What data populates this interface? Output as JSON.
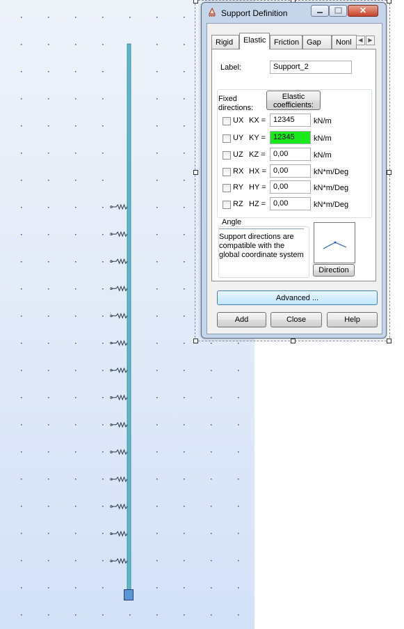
{
  "dialog": {
    "title": "Support Definition",
    "tabs": [
      {
        "label": "Rigid",
        "active": false
      },
      {
        "label": "Elastic",
        "active": true
      },
      {
        "label": "Friction",
        "active": false
      },
      {
        "label": "Gap",
        "active": false
      },
      {
        "label": "Nonl",
        "active": false
      }
    ],
    "label_caption": "Label:",
    "label_value": "Support_2",
    "fixed_directions_label": "Fixed\ndirections:",
    "elastic_coefficients_button": "Elastic coefficients:",
    "rows": [
      {
        "dir": "UX",
        "coef": "KX =",
        "value": "12345",
        "unit": "kN/m",
        "checked": false,
        "highlight": false
      },
      {
        "dir": "UY",
        "coef": "KY =",
        "value": "12345",
        "unit": "kN/m",
        "checked": false,
        "highlight": true
      },
      {
        "dir": "UZ",
        "coef": "KZ =",
        "value": "0,00",
        "unit": "kN/m",
        "checked": false,
        "highlight": false
      },
      {
        "dir": "RX",
        "coef": "HX =",
        "value": "0,00",
        "unit": "kN*m/Deg",
        "checked": false,
        "highlight": false
      },
      {
        "dir": "RY",
        "coef": "HY =",
        "value": "0,00",
        "unit": "kN*m/Deg",
        "checked": false,
        "highlight": false
      },
      {
        "dir": "RZ",
        "coef": "HZ =",
        "value": "0,00",
        "unit": "kN*m/Deg",
        "checked": false,
        "highlight": false
      }
    ],
    "angle_label": "Angle",
    "angle_text": "Support directions are compatible with the global coordinate system",
    "direction_button": "Direction",
    "advanced_button": "Advanced ...",
    "add_button": "Add",
    "close_button": "Close",
    "help_button": "Help",
    "close_glyph": "✕"
  },
  "colors": {
    "member": "#5fb8c7",
    "spring": "#2a3a4a",
    "grid_dot": "#2f4fa8",
    "highlight": "#19e81b"
  }
}
